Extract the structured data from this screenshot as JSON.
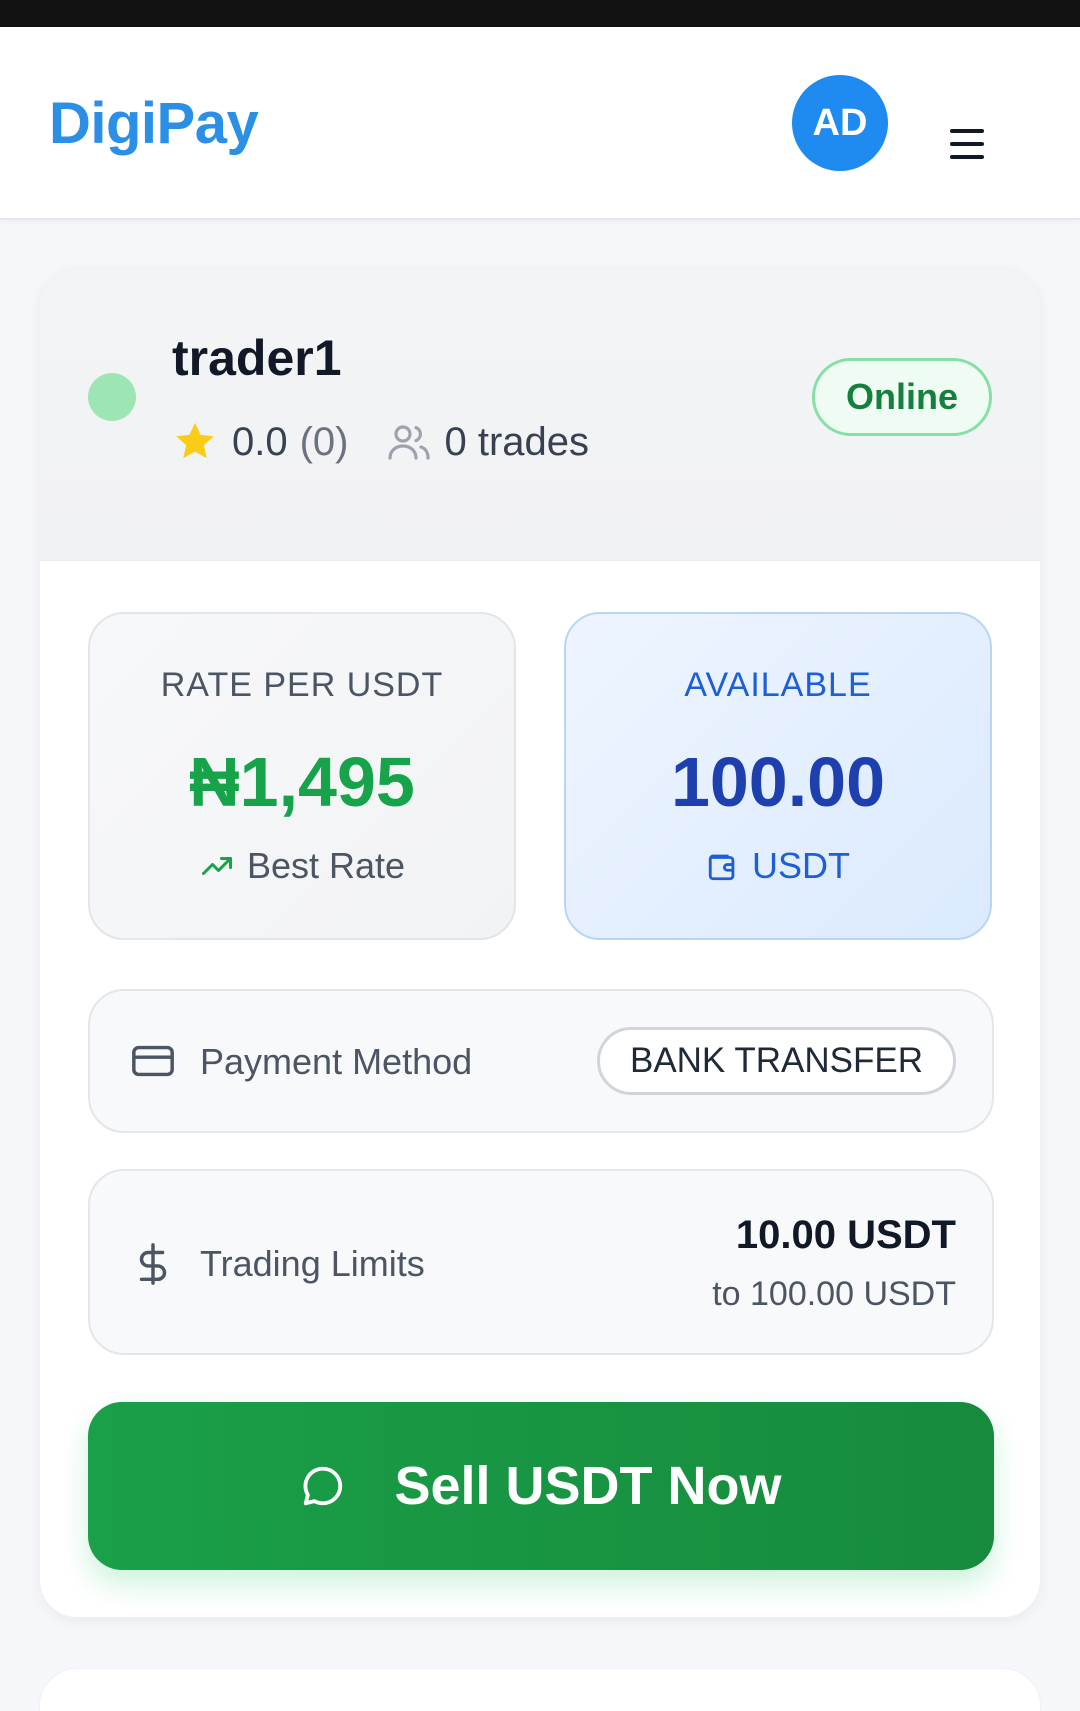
{
  "header": {
    "brand": "DigiPay",
    "avatar_initials": "AD",
    "brand_color": "#2b8fe6"
  },
  "trader": {
    "name": "trader1",
    "rating": "0.0",
    "rating_count": "(0)",
    "trades": "0 trades",
    "status": "Online"
  },
  "rate": {
    "label": "RATE PER USDT",
    "value": "₦1,495",
    "sub": "Best Rate"
  },
  "available": {
    "label": "AVAILABLE",
    "value": "100.00",
    "unit": "USDT"
  },
  "payment": {
    "label": "Payment Method",
    "method": "BANK TRANSFER"
  },
  "limits": {
    "label": "Trading Limits",
    "min": "10.00 USDT",
    "max": "to 100.00 USDT"
  },
  "action": {
    "sell_label": "Sell USDT Now"
  },
  "icons": {
    "menu": "hamburger-menu-icon",
    "star": "star-icon",
    "users": "users-icon",
    "trend": "trending-up-icon",
    "wallet": "wallet-icon",
    "card": "credit-card-icon",
    "dollar": "dollar-icon",
    "chat": "chat-bubble-icon"
  },
  "colors": {
    "success": "#16a34a",
    "primary": "#1e40af",
    "button_green": "#1aa048"
  }
}
